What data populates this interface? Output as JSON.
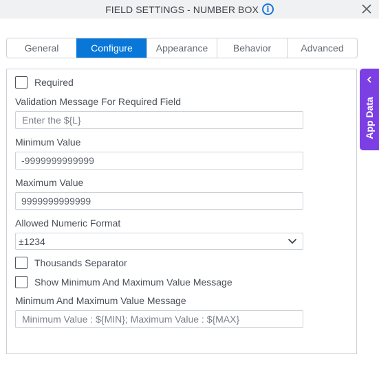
{
  "header": {
    "title": "FIELD SETTINGS - NUMBER BOX",
    "info_icon": "info-icon",
    "close_icon": "close-icon"
  },
  "tabs": [
    {
      "label": "General",
      "active": false
    },
    {
      "label": "Configure",
      "active": true
    },
    {
      "label": "Appearance",
      "active": false
    },
    {
      "label": "Behavior",
      "active": false
    },
    {
      "label": "Advanced",
      "active": false
    }
  ],
  "configure": {
    "required": {
      "label": "Required",
      "checked": false
    },
    "validation_message": {
      "label": "Validation Message For Required Field",
      "placeholder": "Enter the ${L}",
      "value": ""
    },
    "minimum_value": {
      "label": "Minimum Value",
      "value": "-9999999999999"
    },
    "maximum_value": {
      "label": "Maximum Value",
      "value": "9999999999999"
    },
    "numeric_format": {
      "label": "Allowed Numeric Format",
      "selected": "±1234"
    },
    "thousands_separator": {
      "label": "Thousands Separator",
      "checked": false
    },
    "show_min_max_message": {
      "label": "Show Minimum And Maximum Value Message",
      "checked": false
    },
    "min_max_message": {
      "label": "Minimum And Maximum Value Message",
      "placeholder": "Minimum Value : ${MIN}; Maximum Value : ${MAX}",
      "value": ""
    }
  },
  "side_panel": {
    "label": "App Data",
    "color": "#7b3fe4"
  },
  "colors": {
    "accent": "#0877d8",
    "header_bg": "#f0f1f3",
    "info": "#1a73d9"
  }
}
